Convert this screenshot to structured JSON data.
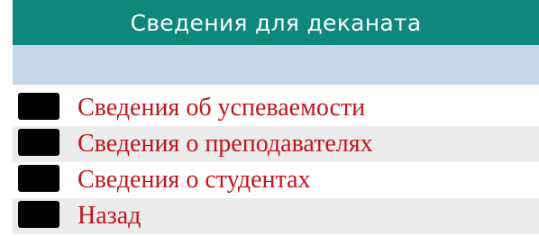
{
  "window": {
    "title": "Сведения для деканата"
  },
  "menu": {
    "items": [
      {
        "label": "Сведения об успеваемости",
        "icon": "black-square-button-icon"
      },
      {
        "label": "Сведения о преподавателях",
        "icon": "black-square-button-icon"
      },
      {
        "label": "Сведения о студентах",
        "icon": "black-square-button-icon"
      },
      {
        "label": "Назад",
        "icon": "black-square-button-icon"
      }
    ]
  },
  "colors": {
    "title_bar": "#0e877d",
    "sub_bar": "#c7d6ec",
    "label_text": "#c0161c",
    "bullet": "#000000"
  }
}
